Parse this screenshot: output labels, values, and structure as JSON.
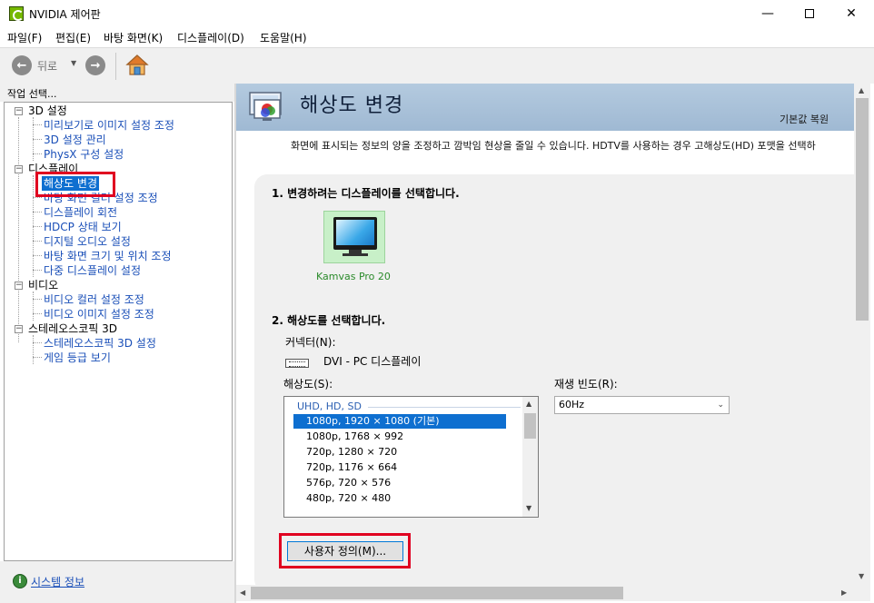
{
  "window": {
    "title": "NVIDIA 제어판",
    "minimize": "—",
    "close": "✕"
  },
  "menu": [
    "파일(F)",
    "편집(E)",
    "바탕 화면(K)",
    "디스플레이(D)",
    "도움말(H)"
  ],
  "toolbar": {
    "back_label": "뒤로",
    "back_icon": "←",
    "forward_icon": "→",
    "dropdown_icon": "▼"
  },
  "left_pane": {
    "header": "작업 선택...",
    "tree": [
      {
        "label": "3D 설정",
        "type": "category",
        "expander": "−"
      },
      {
        "label": "미리보기로 이미지 설정 조정",
        "type": "leaf"
      },
      {
        "label": "3D 설정 관리",
        "type": "leaf"
      },
      {
        "label": "PhysX 구성 설정",
        "type": "leaf"
      },
      {
        "label": "디스플레이",
        "type": "category",
        "expander": "−"
      },
      {
        "label": "해상도 변경",
        "type": "leaf",
        "selected": true
      },
      {
        "label": "바탕 화면 컬러 설정 조정",
        "type": "leaf"
      },
      {
        "label": "디스플레이 회전",
        "type": "leaf"
      },
      {
        "label": "HDCP 상태 보기",
        "type": "leaf"
      },
      {
        "label": "디지털 오디오 설정",
        "type": "leaf"
      },
      {
        "label": "바탕 화면 크기 및 위치 조정",
        "type": "leaf"
      },
      {
        "label": "다중 디스플레이 설정",
        "type": "leaf"
      },
      {
        "label": "비디오",
        "type": "category",
        "expander": "−"
      },
      {
        "label": "비디오 컬러 설정 조정",
        "type": "leaf"
      },
      {
        "label": "비디오 이미지 설정 조정",
        "type": "leaf"
      },
      {
        "label": "스테레오스코픽 3D",
        "type": "category",
        "expander": "−"
      },
      {
        "label": "스테레오스코픽 3D 설정",
        "type": "leaf"
      },
      {
        "label": "게임 등급 보기",
        "type": "leaf"
      }
    ],
    "footer_link": "시스템 정보",
    "footer_icon": "i"
  },
  "page": {
    "title": "해상도 변경",
    "restore_defaults": "기본값 복원",
    "description": "화면에 표시되는 정보의 양을 조정하고 깜박임 현상을 줄일 수 있습니다. HDTV를 사용하는 경우 고해상도(HD) 포맷을 선택하",
    "step1": "1. 변경하려는 디스플레이를 선택합니다.",
    "display_name": "Kamvas Pro 20",
    "step2": "2. 해상도를 선택합니다.",
    "connector_label": "커넥터(N):",
    "connector_value": "DVI - PC 디스플레이",
    "resolution_label": "해상도(S):",
    "refresh_label": "재생 빈도(R):",
    "refresh_value": "60Hz",
    "resolution_group": "UHD, HD, SD",
    "resolutions": [
      "1080p, 1920 × 1080 (기본)",
      "1080p, 1768 × 992",
      "720p, 1280 × 720",
      "720p, 1176 × 664",
      "576p, 720 × 576",
      "480p, 720 × 480"
    ],
    "selected_resolution_index": 0,
    "custom_button": "사용자 정의(M)..."
  },
  "colors": {
    "accent": "#0e6fd0",
    "highlight_box": "#e00020",
    "header_bg": "#a8c0d8",
    "link": "#1a4fb8",
    "nvidia_green": "#76b900"
  }
}
